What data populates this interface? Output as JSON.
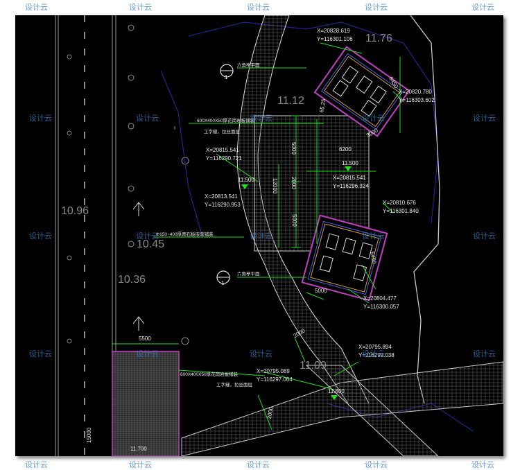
{
  "watermark": "设计云",
  "elevations": {
    "e1": "11.76",
    "e2": "11.12",
    "e3": "10.96",
    "e4": "10.45",
    "e5": "10.36",
    "e6": "11.09",
    "p1": "11.500",
    "p2": "11.500",
    "p3": "11.800",
    "p4": "11.700"
  },
  "coords": {
    "c1x": "X=20828.619",
    "c1y": "Y=116301.106",
    "c2x": "X=20820.780",
    "c2y": "Y=116303.602",
    "c3x": "X=20815.541",
    "c3y": "Y=116290.721",
    "c4x": "X=20815.541",
    "c4y": "Y=116296.324",
    "c5x": "X=20813.541",
    "c5y": "Y=116290.953",
    "c6x": "X=20810.676",
    "c6y": "Y=116301.840",
    "c7x": "X=20804.477",
    "c7y": "Y=116300.057",
    "c8x": "X=20795.894",
    "c8y": "Y=116299.038",
    "c9x": "X=20795.089",
    "c9y": "Y=116297.064"
  },
  "dims": {
    "d6450a": "6450",
    "d3000": "3000",
    "d6200": "6200",
    "d5000a": "5000",
    "d12000": "12000",
    "d2000a": "2000",
    "d5000b": "5000",
    "d6450b": "6450",
    "d5000c": "5000",
    "d2000b": "2000",
    "d2000c": "2000",
    "d5500": "5500",
    "d15000": "15000",
    "d6525": "65.25"
  },
  "notes": {
    "n1": "六角亭平面",
    "n2": "600X400X50厚花岗岩板铺装",
    "n2b": "工字缝，拉丝面层",
    "n3": "Φ150~400厚青石板嵌草铺装",
    "n4": "六角亭平面",
    "n5": "600X400X50厚花岗岩板铺装",
    "n5b": "工字缝，拉丝面层"
  },
  "markers": {
    "m1": "1",
    "m2": "1"
  }
}
